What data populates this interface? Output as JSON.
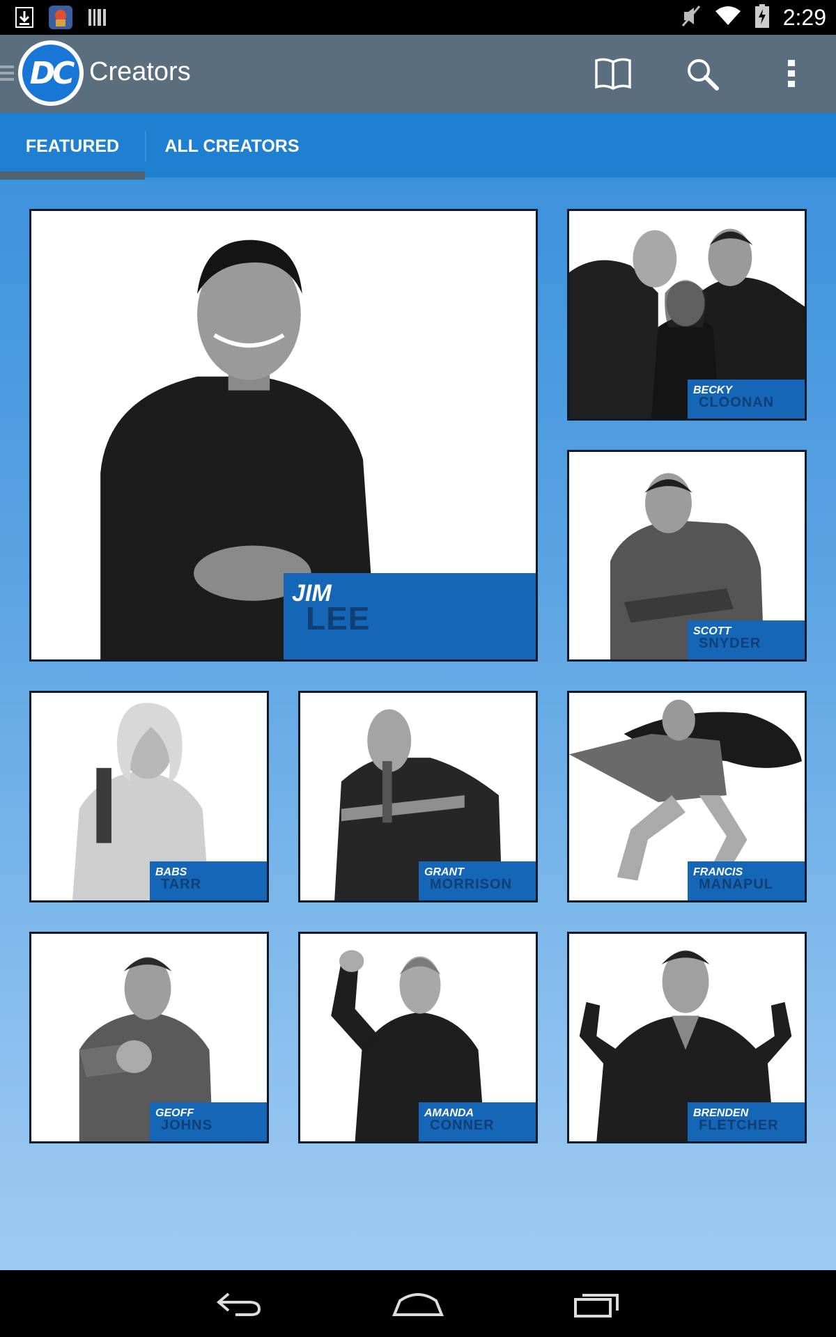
{
  "status_bar": {
    "time": "2:29",
    "icons": [
      "download-icon",
      "app-notification-icon",
      "barcode-icon",
      "mute-icon",
      "wifi-icon",
      "battery-charging-icon"
    ]
  },
  "app_bar": {
    "logo_text": "DC",
    "title": "Creators",
    "actions": [
      "book-icon",
      "search-icon",
      "overflow-menu-icon"
    ]
  },
  "tabs": [
    {
      "label": "FEATURED",
      "selected": true
    },
    {
      "label": "ALL CREATORS",
      "selected": false
    }
  ],
  "creators": [
    {
      "first": "JIM",
      "last": "LEE"
    },
    {
      "first": "BECKY",
      "last": "CLOONAN"
    },
    {
      "first": "SCOTT",
      "last": "SNYDER"
    },
    {
      "first": "BABS",
      "last": "TARR"
    },
    {
      "first": "GRANT",
      "last": "MORRISON"
    },
    {
      "first": "FRANCIS",
      "last": "MANAPUL"
    },
    {
      "first": "GEOFF",
      "last": "JOHNS"
    },
    {
      "first": "AMANDA",
      "last": "CONNER"
    },
    {
      "first": "BRENDEN",
      "last": "FLETCHER"
    }
  ],
  "colors": {
    "app_bar": "#5a6e7e",
    "tab_bar": "#1f7fd0",
    "name_tag": "#1566b6",
    "name_last": "#0f3f74"
  },
  "nav": [
    "back-icon",
    "home-icon",
    "recents-icon"
  ]
}
